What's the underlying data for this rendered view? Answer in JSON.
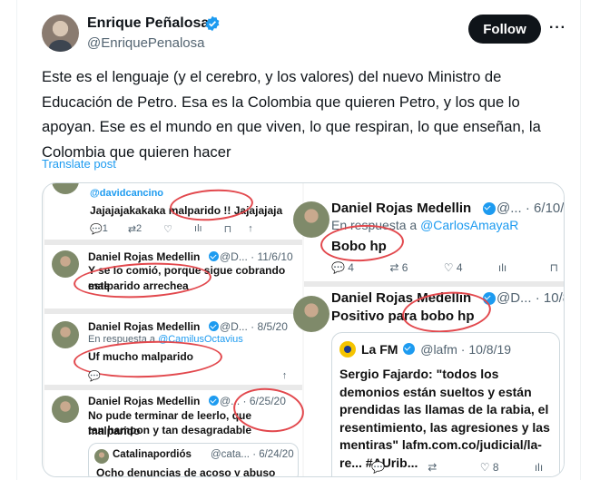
{
  "post": {
    "author_name": "Enrique Peñalosa",
    "handle": "@EnriquePenalosa",
    "follow_label": "Follow",
    "more_label": "···",
    "text": "Este es el lenguaje (y el cerebro, y los valores) del nuevo Ministro de Educación de Petro. Esa es la Colombia que quieren Petro, y los que lo apoyan. Ese es el mundo en que viven, lo que respiran, lo que enseñan, la Colombia que quieren hacer",
    "translate_label": "Translate post"
  },
  "media_left": {
    "t1": {
      "handle": "@davidcancino",
      "text": "Jajajajakakaka malparido !! Jajajajaja",
      "actions": [
        "1",
        "2"
      ]
    },
    "t2": {
      "name": "Daniel Rojas Medellin",
      "meta": "@D... · 11/6/10",
      "line1": "Y se lo comió, porque sigue cobrando este",
      "line2": "malparido arrechea"
    },
    "t3": {
      "name": "Daniel Rojas Medellin",
      "meta": "@D... · 8/5/20",
      "reply_prefix": "En respuesta a",
      "reply_handle": "@CamilusOctavius",
      "text": "Uf mucho malparido"
    },
    "t4": {
      "name": "Daniel Rojas Medellin",
      "meta": "@... · 6/25/20",
      "line1": "No pude terminar de leerlo, que malparido",
      "line2": "tan hampon y tan desagradable",
      "quote_name": "Catalinapordiós",
      "quote_meta": "@cata... · 6/24/20",
      "quote_text": "Ocho denuncias de acoso y abuso"
    }
  },
  "media_right": {
    "t1": {
      "name": "Daniel Rojas Medellin",
      "meta": "@... · 6/10/22",
      "reply_prefix": "En respuesta a",
      "reply_handle": "@CarlosAmayaR",
      "text": "Bobo hp",
      "actions": [
        "4",
        "6",
        "4"
      ]
    },
    "t2": {
      "name": "Daniel Rojas Medellin",
      "meta": "@D... · 10/8/19",
      "text": "Positivo para bobo hp",
      "quote_name": "La FM",
      "quote_meta": "@lafm · 10/8/19",
      "quote_text": "Sergio Fajardo: \"todos los demonios están sueltos y están prendidas las llamas de la rabia, el resentimiento, las agresiones y las mentiras\" lafm.com.co/judicial/la-re... #AUrib...",
      "actions": [
        "8"
      ]
    }
  },
  "colors": {
    "accent": "#1d9bf0",
    "circle": "#e2484d",
    "button_bg": "#0f1419"
  }
}
